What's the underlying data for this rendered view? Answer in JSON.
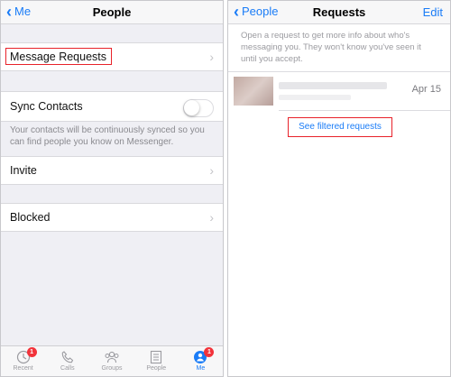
{
  "left": {
    "nav": {
      "back_label": "Me",
      "title": "People"
    },
    "rows": {
      "message_requests": "Message Requests",
      "sync_contacts": "Sync Contacts",
      "sync_footnote": "Your contacts will be continuously synced so you can find people you know on Messenger.",
      "invite": "Invite",
      "blocked": "Blocked"
    },
    "sync_contacts_on": false,
    "tabs": [
      {
        "label": "Recent",
        "icon": "clock-icon",
        "badge": "1"
      },
      {
        "label": "Calls",
        "icon": "phone-icon"
      },
      {
        "label": "Groups",
        "icon": "groups-icon"
      },
      {
        "label": "People",
        "icon": "list-icon"
      },
      {
        "label": "Me",
        "icon": "me-icon",
        "badge": "1"
      }
    ]
  },
  "right": {
    "nav": {
      "back_label": "People",
      "title": "Requests",
      "edit_label": "Edit"
    },
    "info": "Open a request to get more info about who's messaging you. They won't know you've seen it until you accept.",
    "request": {
      "date": "Apr 15"
    },
    "filtered_link": "See filtered requests"
  },
  "colors": {
    "accent": "#1a7cf7",
    "highlight": "#e8222a",
    "badge": "#f2333b"
  }
}
